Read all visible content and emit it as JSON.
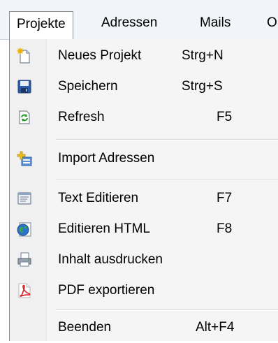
{
  "menubar": {
    "items": [
      "Projekte",
      "Adressen",
      "Mails",
      "O"
    ]
  },
  "menu": {
    "items": [
      {
        "label": "Neues Projekt",
        "shortcut": "Strg+N",
        "icon": "new-project-icon"
      },
      {
        "label": "Speichern",
        "shortcut": "Strg+S",
        "icon": "save-icon"
      },
      {
        "label": "Refresh",
        "shortcut": "F5",
        "icon": "refresh-icon"
      },
      {
        "label": "Import Adressen",
        "shortcut": "",
        "icon": "import-addresses-icon"
      },
      {
        "label": "Text Editieren",
        "shortcut": "F7",
        "icon": "text-edit-icon"
      },
      {
        "label": "Editieren HTML",
        "shortcut": "F8",
        "icon": "globe-icon"
      },
      {
        "label": "Inhalt ausdrucken",
        "shortcut": "",
        "icon": "printer-icon"
      },
      {
        "label": "PDF exportieren",
        "shortcut": "",
        "icon": "pdf-icon"
      },
      {
        "label": "Beenden",
        "shortcut": "Alt+F4",
        "icon": ""
      }
    ]
  }
}
